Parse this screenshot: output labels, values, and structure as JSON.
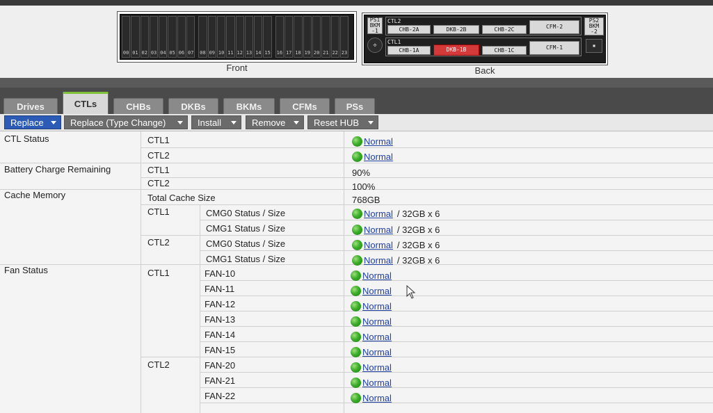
{
  "hardware": {
    "front_label": "Front",
    "back_label": "Back",
    "drive_groups": [
      [
        "00",
        "01",
        "02",
        "03",
        "04",
        "05",
        "06",
        "07"
      ],
      [
        "08",
        "09",
        "10",
        "11",
        "12",
        "13",
        "14",
        "15"
      ],
      [
        "16",
        "17",
        "18",
        "19",
        "20",
        "21",
        "22",
        "23"
      ]
    ],
    "back": {
      "ps1": "PS1",
      "bkm1": "BKM",
      "bkm1_num": "-1",
      "ctl2": "CTL2",
      "ctl1": "CTL1",
      "chb2a": "CHB-2A",
      "dkb2b": "DKB-2B",
      "chb2c": "CHB-2C",
      "cfm2": "CFM-2",
      "chb1a": "CHB-1A",
      "dkb1b": "DKB-1B",
      "chb1c": "CHB-1C",
      "cfm1": "CFM-1",
      "ps2": "PS2",
      "bkm2": "BKM",
      "bkm2_num": "-2"
    }
  },
  "tabs": [
    {
      "label": "Drives",
      "active": false
    },
    {
      "label": "CTLs",
      "active": true
    },
    {
      "label": "CHBs",
      "active": false
    },
    {
      "label": "DKBs",
      "active": false
    },
    {
      "label": "BKMs",
      "active": false
    },
    {
      "label": "CFMs",
      "active": false
    },
    {
      "label": "PSs",
      "active": false
    }
  ],
  "toolbar": {
    "replace": "Replace",
    "replace_type_change": "Replace (Type Change)",
    "install": "Install",
    "remove": "Remove",
    "reset_hub": "Reset HUB"
  },
  "table": {
    "ctl_status": {
      "label": "CTL Status",
      "rows": [
        {
          "ctl": "CTL1",
          "status": "Normal"
        },
        {
          "ctl": "CTL2",
          "status": "Normal"
        }
      ]
    },
    "battery": {
      "label": "Battery Charge Remaining",
      "rows": [
        {
          "ctl": "CTL1",
          "value": "90%"
        },
        {
          "ctl": "CTL2",
          "value": "100%"
        }
      ]
    },
    "cache": {
      "label": "Cache Memory",
      "total_label": "Total Cache Size",
      "total_value": "768GB",
      "rows": [
        {
          "ctl": "CTL1",
          "item": "CMG0 Status / Size",
          "status": "Normal",
          "size": "/ 32GB x 6"
        },
        {
          "ctl": "",
          "item": "CMG1 Status / Size",
          "status": "Normal",
          "size": "/ 32GB x 6"
        },
        {
          "ctl": "CTL2",
          "item": "CMG0 Status / Size",
          "status": "Normal",
          "size": "/ 32GB x 6"
        },
        {
          "ctl": "",
          "item": "CMG1 Status / Size",
          "status": "Normal",
          "size": "/ 32GB x 6"
        }
      ]
    },
    "fan": {
      "label": "Fan Status",
      "ctl1": "CTL1",
      "ctl2": "CTL2",
      "rows": [
        {
          "fan": "FAN-10",
          "status": "Normal"
        },
        {
          "fan": "FAN-11",
          "status": "Normal"
        },
        {
          "fan": "FAN-12",
          "status": "Normal"
        },
        {
          "fan": "FAN-13",
          "status": "Normal"
        },
        {
          "fan": "FAN-14",
          "status": "Normal"
        },
        {
          "fan": "FAN-15",
          "status": "Normal"
        },
        {
          "fan": "FAN-20",
          "status": "Normal"
        },
        {
          "fan": "FAN-21",
          "status": "Normal"
        },
        {
          "fan": "FAN-22",
          "status": "Normal"
        }
      ]
    }
  },
  "colors": {
    "status_ok": "#3cae2a",
    "primary_button": "#2b5bb5",
    "alert_red": "#d43a3a",
    "active_tab_accent": "#7fc23a"
  }
}
